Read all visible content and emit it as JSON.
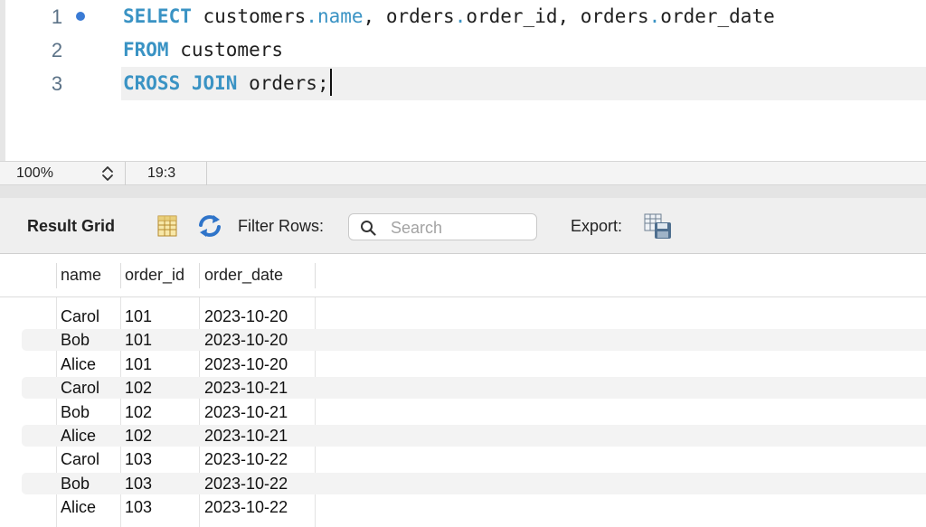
{
  "editor": {
    "lines": [
      {
        "number": "1",
        "has_marker": true,
        "tokens": [
          {
            "t": "SELECT",
            "c": "kw"
          },
          {
            "t": " customers",
            "c": ""
          },
          {
            "t": ".",
            "c": "fld"
          },
          {
            "t": "name",
            "c": "fld"
          },
          {
            "t": ", orders",
            "c": ""
          },
          {
            "t": ".",
            "c": "fld"
          },
          {
            "t": "order_id, orders",
            "c": ""
          },
          {
            "t": ".",
            "c": "fld"
          },
          {
            "t": "order_date",
            "c": ""
          }
        ]
      },
      {
        "number": "2",
        "has_marker": false,
        "tokens": [
          {
            "t": "FROM",
            "c": "kw"
          },
          {
            "t": " customers",
            "c": ""
          }
        ]
      },
      {
        "number": "3",
        "has_marker": false,
        "current": true,
        "tokens": [
          {
            "t": "CROSS JOIN",
            "c": "kw"
          },
          {
            "t": " orders;",
            "c": ""
          }
        ]
      }
    ]
  },
  "status_bar": {
    "zoom": "100%",
    "cursor_position": "19:3"
  },
  "result_toolbar": {
    "title": "Result Grid",
    "filter_label": "Filter Rows:",
    "search_placeholder": "Search",
    "export_label": "Export:"
  },
  "grid": {
    "columns": [
      "name",
      "order_id",
      "order_date"
    ],
    "rows": [
      [
        "Carol",
        "101",
        "2023-10-20"
      ],
      [
        "Bob",
        "101",
        "2023-10-20"
      ],
      [
        "Alice",
        "101",
        "2023-10-20"
      ],
      [
        "Carol",
        "102",
        "2023-10-21"
      ],
      [
        "Bob",
        "102",
        "2023-10-21"
      ],
      [
        "Alice",
        "102",
        "2023-10-21"
      ],
      [
        "Carol",
        "103",
        "2023-10-22"
      ],
      [
        "Bob",
        "103",
        "2023-10-22"
      ],
      [
        "Alice",
        "103",
        "2023-10-22"
      ]
    ]
  },
  "colors": {
    "keyword": "#3a93c4",
    "line_number": "#5b7287",
    "marker": "#3a7bd5"
  },
  "icons": {
    "grid": "grid-view-icon",
    "refresh": "refresh-icon",
    "search": "search-icon",
    "export": "export-icon",
    "stepper": "zoom-stepper-icon"
  }
}
